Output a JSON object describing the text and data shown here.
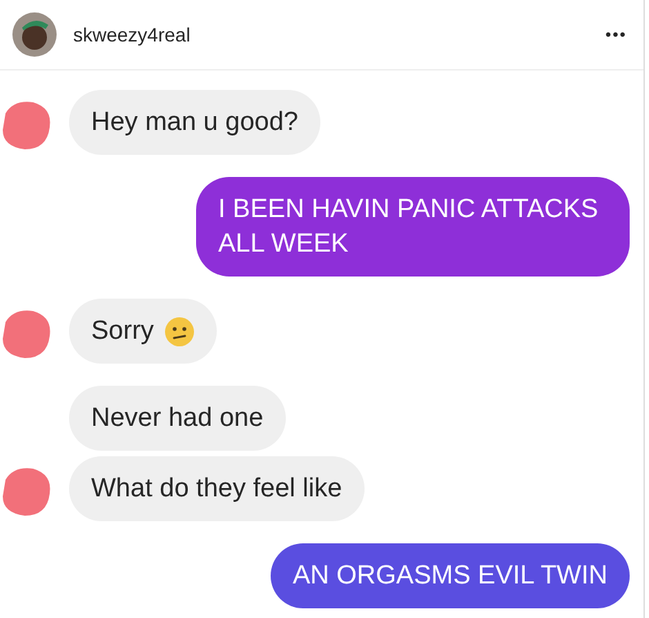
{
  "header": {
    "username": "skweezy4real",
    "more": "•••"
  },
  "messages": [
    {
      "kind": "incoming",
      "text": "Hey man u good?",
      "avatar_redacted": true,
      "emoji": false
    },
    {
      "kind": "outgoing",
      "text": "I BEEN HAVIN PANIC ATTACKS ALL WEEK",
      "color": "#8e2fd8"
    },
    {
      "kind": "incoming",
      "text": "Sorry",
      "avatar_redacted": true,
      "emoji": true
    },
    {
      "kind": "incoming",
      "text": "Never had one",
      "avatar_redacted": false,
      "emoji": false
    },
    {
      "kind": "incoming",
      "text": "What do they feel like",
      "avatar_redacted": true,
      "emoji": false
    },
    {
      "kind": "outgoing",
      "text": "AN ORGASMS EVIL TWIN",
      "color": "#5a4ee0"
    }
  ]
}
